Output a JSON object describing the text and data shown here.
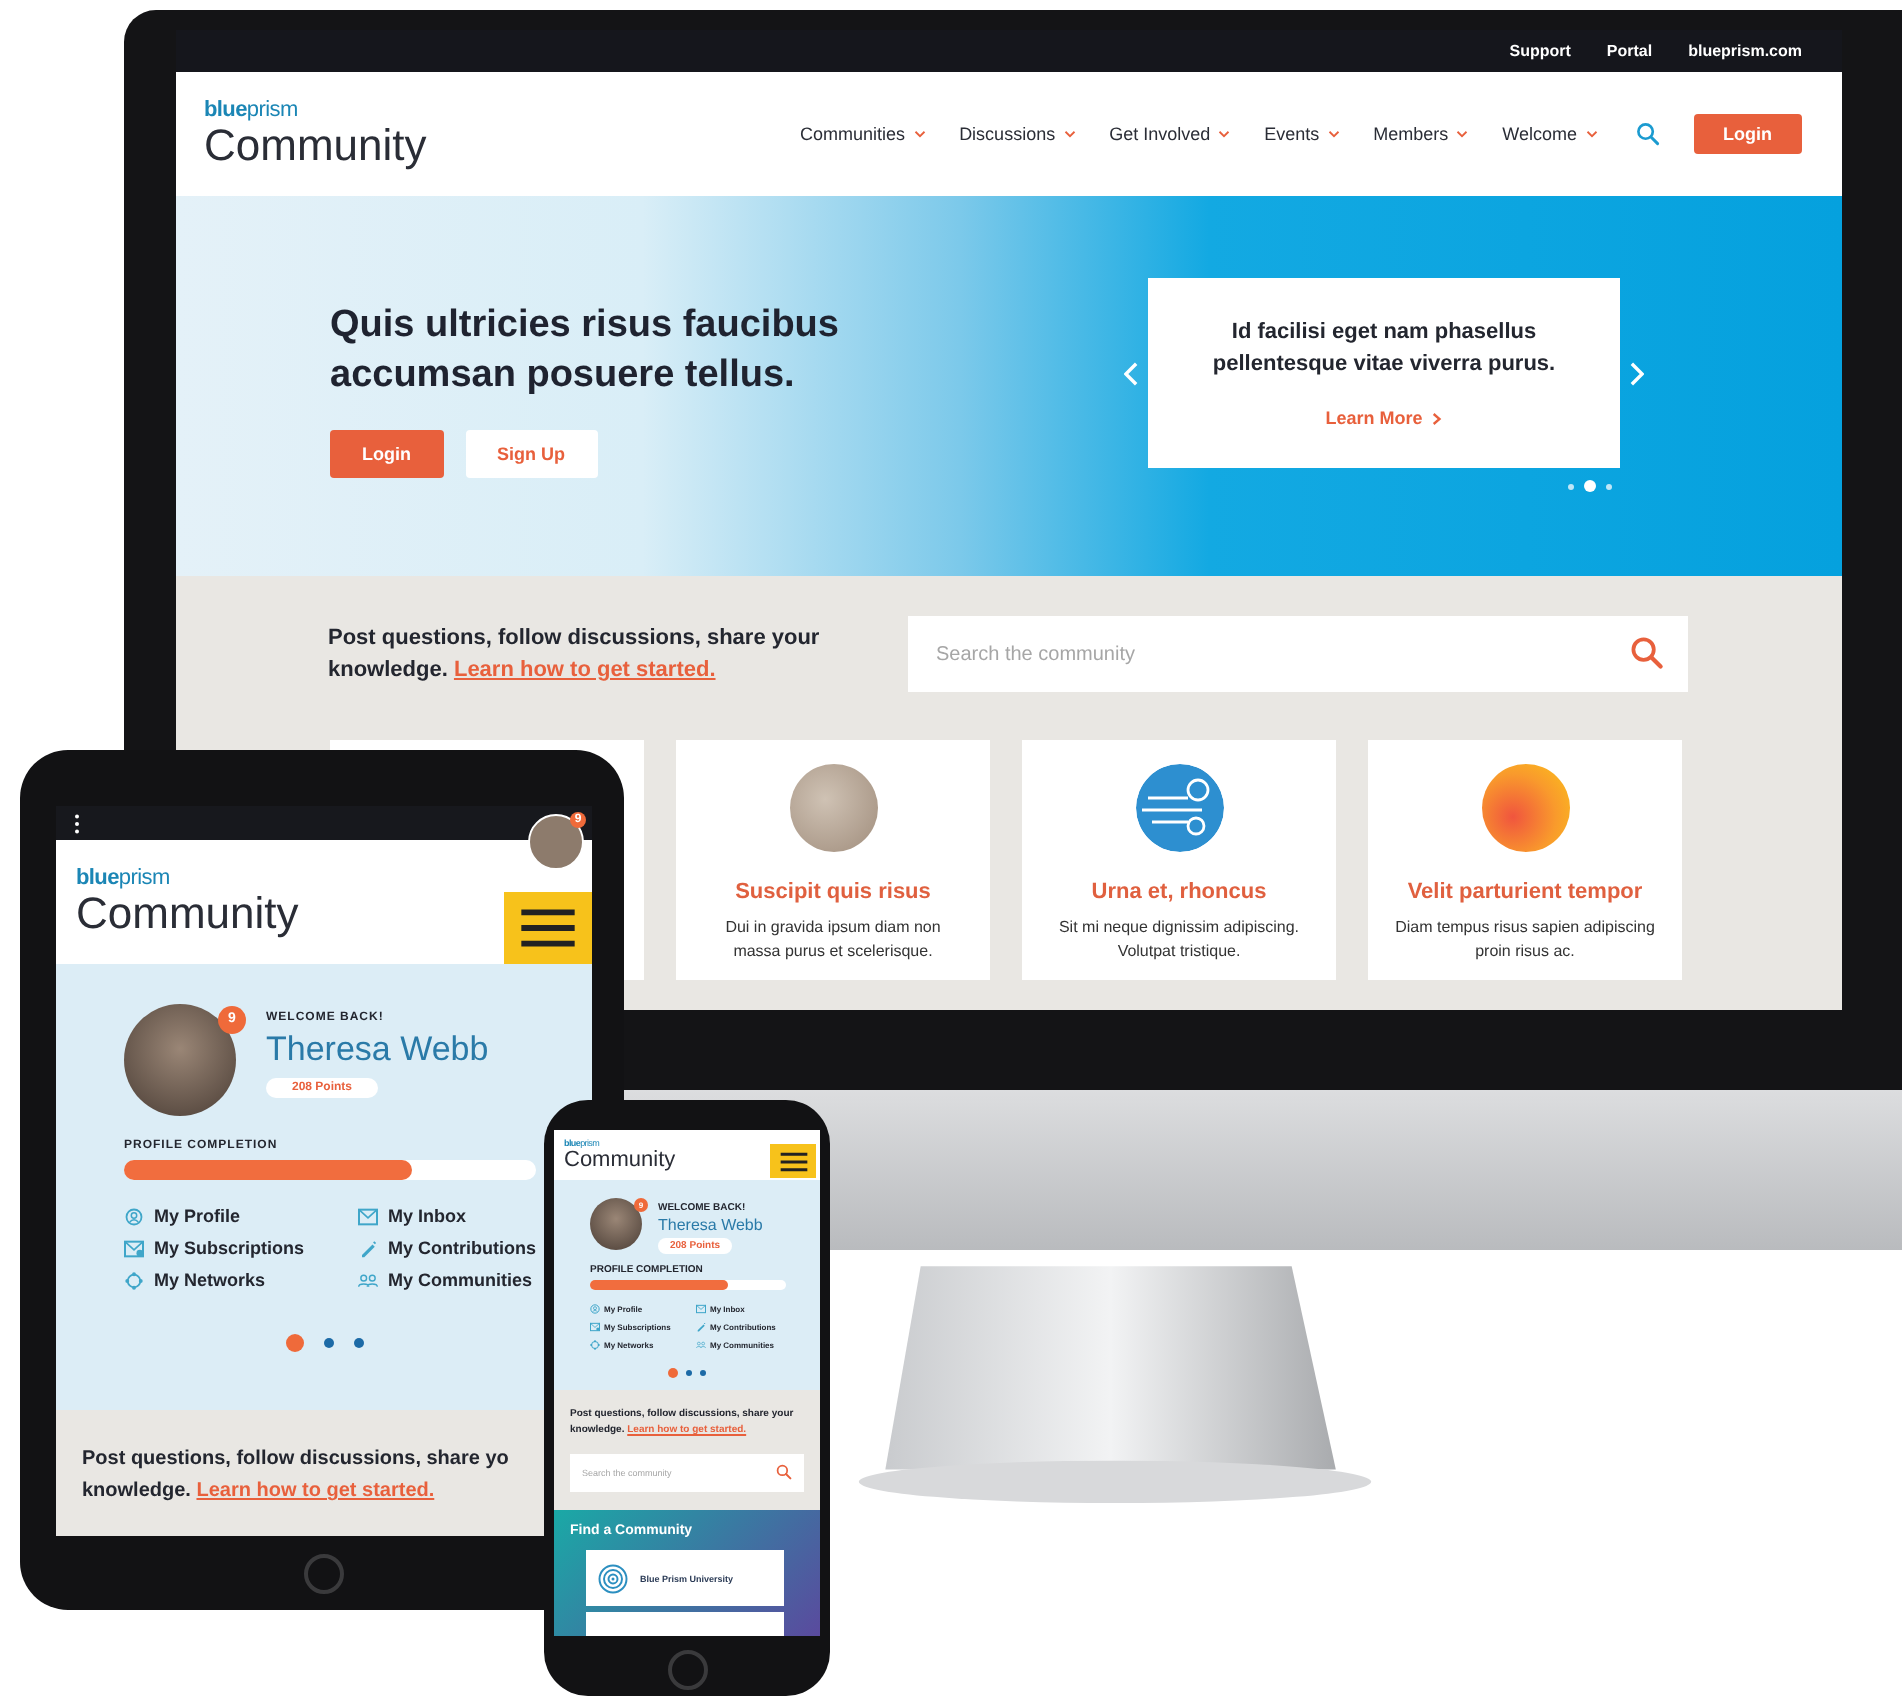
{
  "desktop": {
    "utility_links": [
      "Support",
      "Portal",
      "blueprism.com"
    ],
    "logo": {
      "brand": "**blue**prism",
      "title": "Community"
    },
    "nav": [
      {
        "label": "Communities"
      },
      {
        "label": "Discussions"
      },
      {
        "label": "Get Involved"
      },
      {
        "label": "Events"
      },
      {
        "label": "Members"
      },
      {
        "label": "Welcome"
      }
    ],
    "login_button": "Login",
    "hero": {
      "headline": "Quis ultricies risus faucibus accumsan posuere tellus.",
      "buttons": [
        {
          "label": "Login",
          "kind": "primary"
        },
        {
          "label": "Sign Up",
          "kind": "secondary"
        }
      ],
      "slide": {
        "text": "Id facilisi eget nam phasellus pellentesque vitae viverra purus.",
        "link": "Learn More"
      },
      "dots": [
        {
          "selected": false
        },
        {
          "selected": true
        },
        {
          "selected": false
        }
      ]
    },
    "intro": {
      "text": "Post questions, follow discussions, share your knowledge.",
      "link": "Learn how to get started."
    },
    "search": {
      "placeholder": "Search the community"
    },
    "cards": [
      {
        "kind": "covered"
      },
      {
        "kind": "photo",
        "title": "Suscipit quis risus",
        "text": "Dui in gravida ipsum diam non massa purus et scelerisque."
      },
      {
        "kind": "wave",
        "title": "Urna et, rhoncus",
        "text": "Sit mi neque dignissim adipiscing. Volutpat tristique."
      },
      {
        "kind": "glow",
        "title": "Velit parturient tempor",
        "text": "Diam tempus risus sapien adipiscing proin risus ac."
      }
    ]
  },
  "tablet": {
    "top_bar": {
      "avatar_badge": "9"
    },
    "logo": {
      "brand": "**blue**prism",
      "title": "Community"
    },
    "profile": {
      "badge": "9",
      "welcome": "WELCOME BACK!",
      "name": "Theresa Webb",
      "points": "208 Points"
    },
    "completion": {
      "label": "PROFILE COMPLETION",
      "level": 0.7
    },
    "links": [
      {
        "label": "My Profile",
        "kind": "profile"
      },
      {
        "label": "My Inbox",
        "kind": "inbox"
      },
      {
        "label": "My Subscriptions",
        "kind": "subscriptions"
      },
      {
        "label": "My Contributions",
        "kind": "contributions"
      },
      {
        "label": "My Networks",
        "kind": "networks"
      },
      {
        "label": "My Communities",
        "kind": "communities"
      }
    ],
    "dots": [
      {
        "selected": true
      },
      {
        "selected": false
      },
      {
        "selected": false
      }
    ],
    "intro": {
      "lines": [
        "Post questions, follow discussions, share yo",
        "knowledge."
      ],
      "link": "Learn how to get started."
    }
  },
  "phone": {
    "logo": {
      "brand": "**blue**prism",
      "title": "Community"
    },
    "profile": {
      "badge": "9",
      "welcome": "WELCOME BACK!",
      "name": "Theresa Webb",
      "points": "208 Points"
    },
    "completion": {
      "label": "PROFILE COMPLETION",
      "level": 0.7
    },
    "links": [
      {
        "label": "My Profile",
        "kind": "profile"
      },
      {
        "label": "My Inbox",
        "kind": "inbox"
      },
      {
        "label": "My Subscriptions",
        "kind": "subscriptions"
      },
      {
        "label": "My Contributions",
        "kind": "contributions"
      },
      {
        "label": "My Networks",
        "kind": "networks"
      },
      {
        "label": "My Communities",
        "kind": "communities"
      }
    ],
    "dots": [
      {
        "selected": true
      },
      {
        "selected": false
      },
      {
        "selected": false
      }
    ],
    "intro": {
      "lines": [
        "Post questions, follow discussions, share your",
        "knowledge."
      ],
      "link": "Learn how to get started."
    },
    "search": {
      "placeholder": "Search the community"
    },
    "find": {
      "title": "Find a Community",
      "cards": [
        {
          "kind": "full",
          "title": "Blue Prism University"
        },
        {
          "kind": "cut"
        }
      ]
    }
  }
}
